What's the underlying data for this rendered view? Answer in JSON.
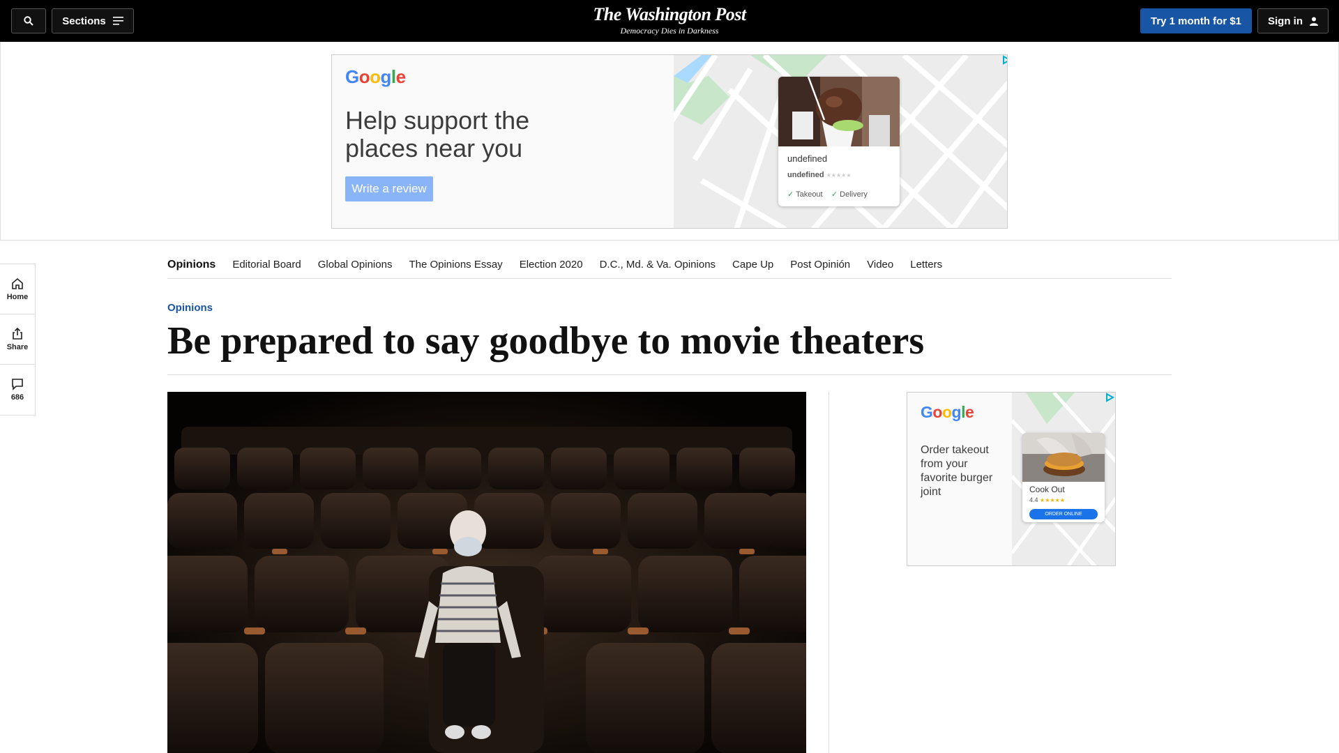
{
  "header": {
    "sections_label": "Sections",
    "masthead": "The Washington Post",
    "tagline": "Democracy Dies in Darkness",
    "subscribe_label": "Try 1 month for $1",
    "signin_label": "Sign in"
  },
  "top_ad": {
    "logo": "Google",
    "headline": "Help support the places near you",
    "cta": "Write a review",
    "card_title": "undefined",
    "card_rating": "undefined",
    "card_stars": "★★★★★",
    "option_1": "Takeout",
    "option_2": "Delivery"
  },
  "subnav": {
    "brand": "Opinions",
    "items": [
      "Editorial Board",
      "Global Opinions",
      "The Opinions Essay",
      "Election 2020",
      "D.C., Md. & Va. Opinions",
      "Cape Up",
      "Post Opinión",
      "Video",
      "Letters"
    ]
  },
  "rail": {
    "home": "Home",
    "share": "Share",
    "comments": "686"
  },
  "article": {
    "kicker": "Opinions",
    "headline": "Be prepared to say goodbye to movie theaters"
  },
  "side_ad": {
    "logo": "Google",
    "text": "Order takeout from your favorite burger joint",
    "card_title": "Cook Out",
    "card_rating": "4.4",
    "card_stars": "★★★★★",
    "cta": "ORDER ONLINE"
  },
  "colors": {
    "accent": "#1955a5",
    "google_blue": "#4285f4"
  }
}
